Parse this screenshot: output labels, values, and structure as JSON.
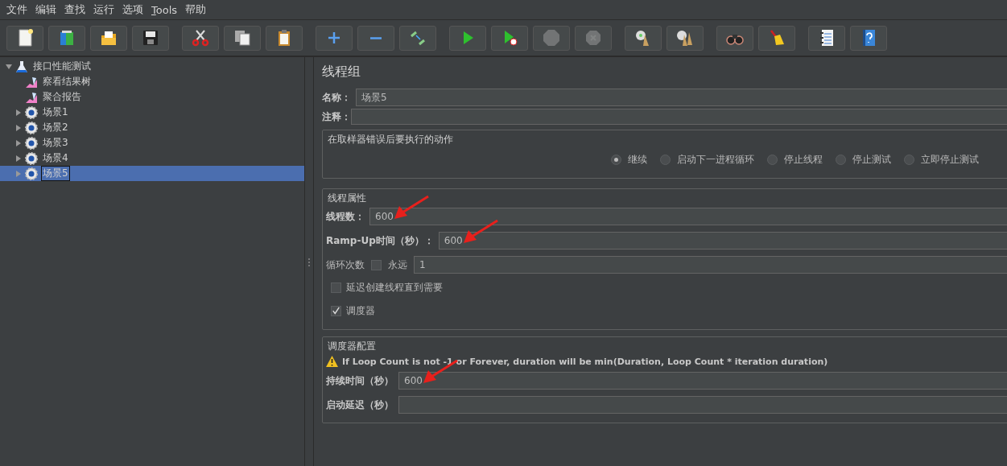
{
  "menu": [
    {
      "label": "文件",
      "mnemonic": false
    },
    {
      "label": "编辑",
      "mnemonic": false
    },
    {
      "label": "查找",
      "mnemonic": false
    },
    {
      "label": "运行",
      "mnemonic": false
    },
    {
      "label": "选项",
      "mnemonic": false
    },
    {
      "label": "Tools",
      "mnemonic": true
    },
    {
      "label": "帮助",
      "mnemonic": false
    }
  ],
  "toolbar": [
    [
      {
        "disabled": false
      },
      {
        "disabled": false
      },
      {
        "disabled": false
      },
      {
        "disabled": false
      }
    ],
    [
      {
        "disabled": false
      },
      {
        "disabled": false
      },
      {
        "disabled": false
      }
    ],
    [
      {
        "disabled": false
      },
      {
        "disabled": false
      },
      {
        "disabled": false
      }
    ],
    [
      {
        "disabled": false
      },
      {
        "disabled": false
      },
      {
        "disabled": true
      },
      {
        "disabled": true
      }
    ],
    [
      {
        "disabled": false
      },
      {
        "disabled": false
      }
    ],
    [
      {
        "disabled": false
      },
      {
        "disabled": false
      }
    ],
    [
      {
        "disabled": false
      },
      {
        "disabled": false
      }
    ]
  ],
  "tree": [
    {
      "label": "接口性能测试",
      "kind": "plan",
      "expanded": true,
      "selected": false,
      "children": [
        {
          "label": "察看结果树",
          "kind": "listener",
          "selected": false
        },
        {
          "label": "聚合报告",
          "kind": "listener",
          "selected": false
        },
        {
          "label": "场景1",
          "kind": "group",
          "expanded": false,
          "selected": false
        },
        {
          "label": "场景2",
          "kind": "group",
          "expanded": false,
          "selected": false
        },
        {
          "label": "场景3",
          "kind": "group",
          "expanded": false,
          "selected": false
        },
        {
          "label": "场景4",
          "kind": "group",
          "expanded": false,
          "selected": false
        },
        {
          "label": "场景5",
          "kind": "group",
          "expanded": false,
          "selected": true
        }
      ]
    }
  ],
  "editor": {
    "title": "线程组",
    "name": {
      "label": "名称：",
      "value": "场景5"
    },
    "comment": {
      "label": "注释："
    },
    "error_action": {
      "title": "在取样器错误后要执行的动作",
      "options": [
        {
          "label": "继续",
          "selected": true
        },
        {
          "label": "启动下一进程循环",
          "selected": false
        },
        {
          "label": "停止线程",
          "selected": false
        },
        {
          "label": "停止测试",
          "selected": false
        },
        {
          "label": "立即停止测试",
          "selected": false
        }
      ]
    },
    "thread_properties": {
      "title": "线程属性",
      "threads": {
        "label": "线程数：",
        "value": "600",
        "annotated": true
      },
      "ramp_up": {
        "label": "Ramp-Up时间（秒）：",
        "value": "600",
        "annotated": true
      },
      "loop": {
        "label": "循环次数",
        "forever": {
          "label": "永远",
          "checked": false
        },
        "value": "1"
      },
      "delay_create": {
        "label": "延迟创建线程直到需要",
        "checked": false
      },
      "scheduler": {
        "label": "调度器",
        "checked": true
      }
    },
    "scheduler_config": {
      "title": "调度器配置",
      "warning": "If Loop Count is not -1 or Forever, duration will be min(Duration, Loop Count * iteration duration)",
      "duration": {
        "label": "持续时间（秒）",
        "value": "600",
        "annotated": true
      },
      "startup_delay": {
        "label": "启动延迟（秒）"
      }
    }
  }
}
